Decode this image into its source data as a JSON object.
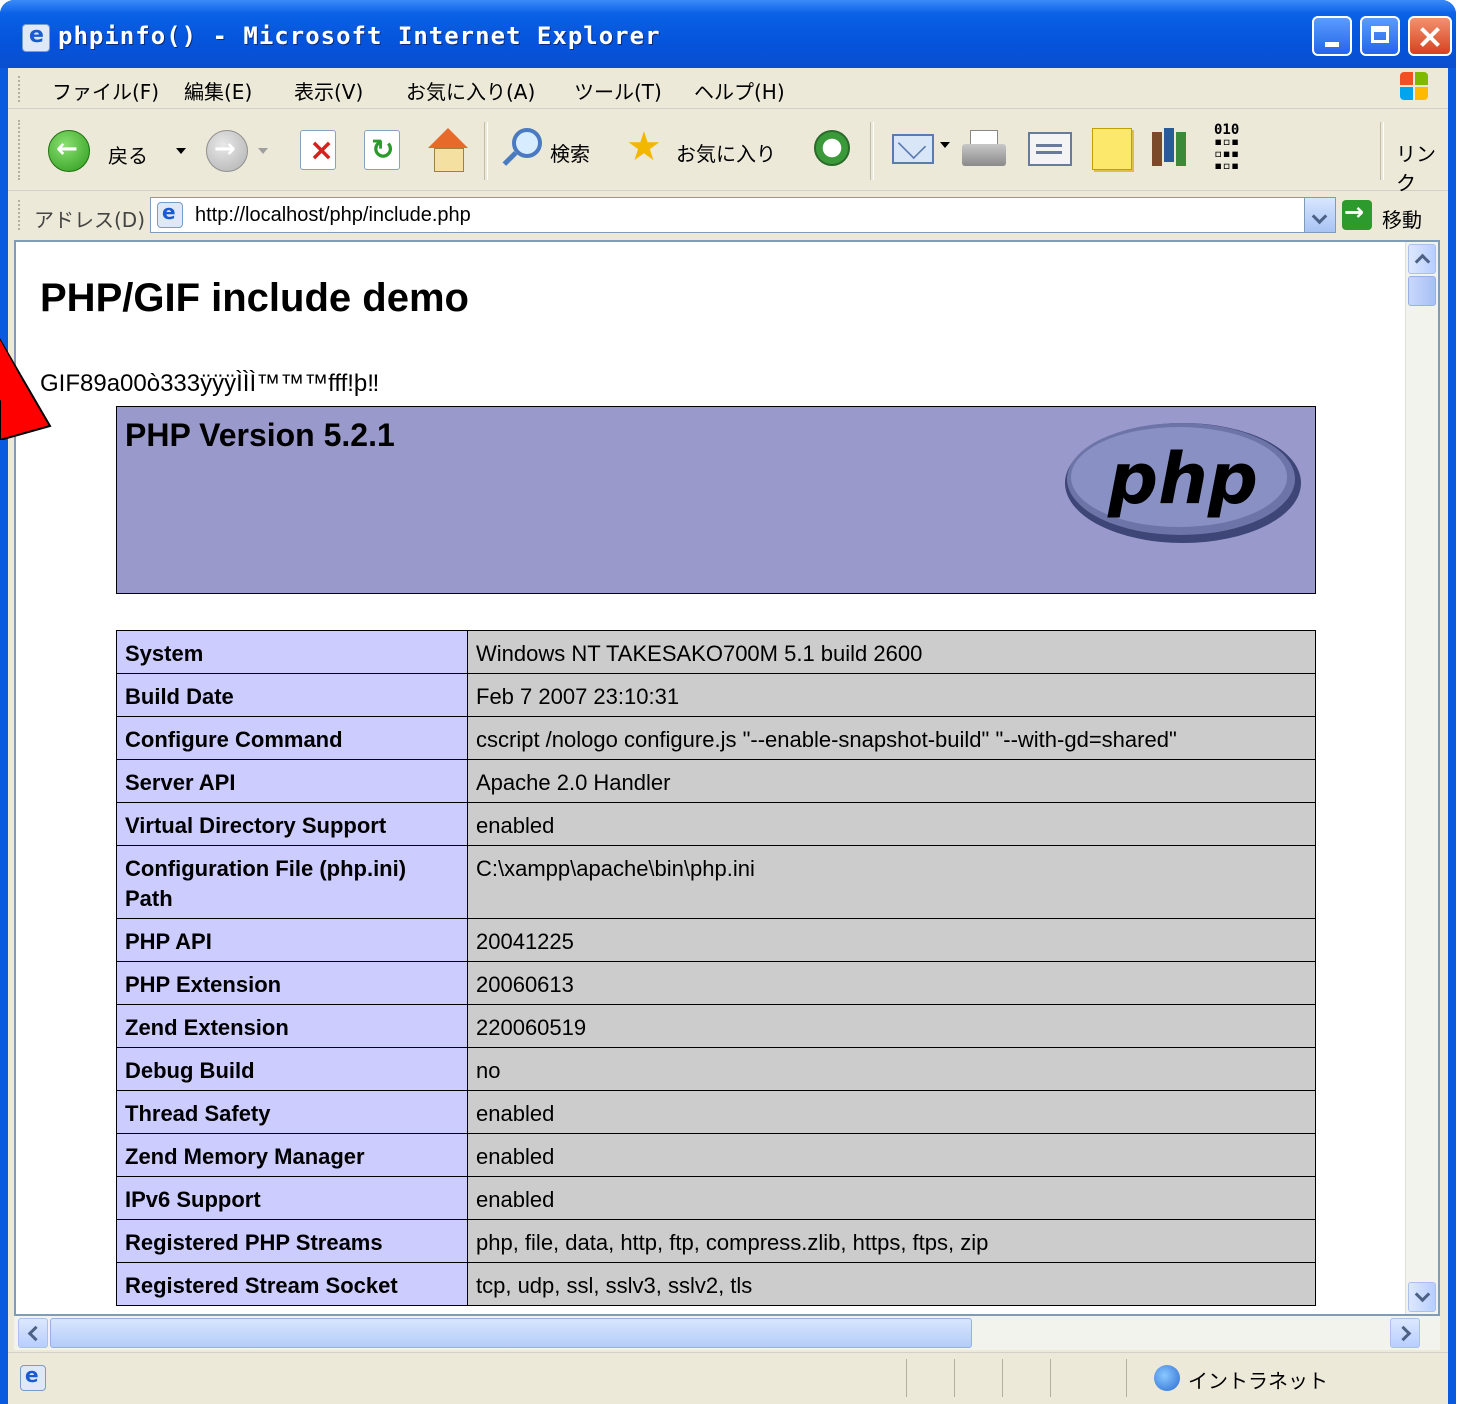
{
  "window": {
    "title": "phpinfo() - Microsoft Internet Explorer"
  },
  "menubar": {
    "items": [
      "ファイル(F)",
      "編集(E)",
      "表示(V)",
      "お気に入り(A)",
      "ツール(T)",
      "ヘルプ(H)"
    ]
  },
  "toolbar": {
    "back_label": "戻る",
    "search_label": "検索",
    "favorites_label": "お気に入り",
    "links_label": "リンク"
  },
  "address": {
    "label": "アドレス(D)",
    "url": "http://localhost/php/include.php",
    "go_label": "移動"
  },
  "page": {
    "title": "PHP/GIF include demo",
    "gif_text": "GIF89a00ò333ÿÿÿÌÌÌ™™™fff!þ‼",
    "php_version": "PHP Version 5.2.1",
    "logo_text": "php",
    "rows": [
      {
        "key": "System",
        "value": "Windows NT TAKESAKO700M 5.1 build 2600"
      },
      {
        "key": "Build Date",
        "value": "Feb 7 2007 23:10:31"
      },
      {
        "key": "Configure Command",
        "value": "cscript /nologo configure.js \"--enable-snapshot-build\" \"--with-gd=shared\""
      },
      {
        "key": "Server API",
        "value": "Apache 2.0 Handler"
      },
      {
        "key": "Virtual Directory Support",
        "value": "enabled"
      },
      {
        "key": "Configuration File (php.ini) Path",
        "value": "C:\\xampp\\apache\\bin\\php.ini"
      },
      {
        "key": "PHP API",
        "value": "20041225"
      },
      {
        "key": "PHP Extension",
        "value": "20060613"
      },
      {
        "key": "Zend Extension",
        "value": "220060519"
      },
      {
        "key": "Debug Build",
        "value": "no"
      },
      {
        "key": "Thread Safety",
        "value": "enabled"
      },
      {
        "key": "Zend Memory Manager",
        "value": "enabled"
      },
      {
        "key": "IPv6 Support",
        "value": "enabled"
      },
      {
        "key": "Registered PHP Streams",
        "value": "php, file, data, http, ftp, compress.zlib, https, ftps, zip"
      },
      {
        "key": "Registered Stream Socket",
        "value": "tcp, udp, ssl, sslv3, sslv2, tls"
      }
    ]
  },
  "statusbar": {
    "zone_label": "イントラネット"
  },
  "colors": {
    "php_header": "#9999cc",
    "key_cell": "#ccccff",
    "value_cell": "#cccccc",
    "annotation_arrow": "#ff0000"
  }
}
